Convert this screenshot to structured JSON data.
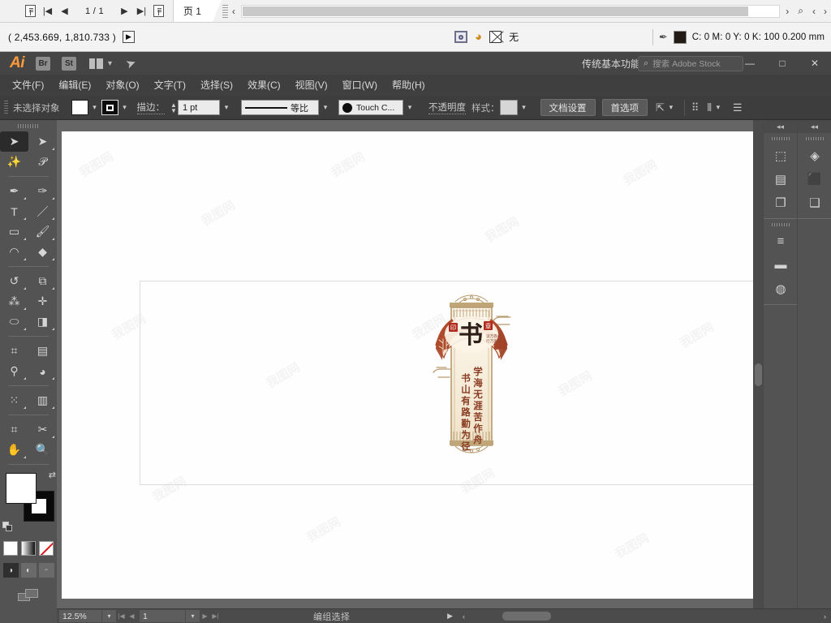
{
  "host": {
    "page_indicator": "1 / 1",
    "tab_label": "页 1",
    "coordinates": "( 2,453.669, 1,810.733 )",
    "fill_none_label": "无",
    "color_readout": "C: 0 M: 0 Y: 0 K: 100  0.200 mm"
  },
  "menubar": {
    "app_logo": "Ai",
    "bridge_badge": "Br",
    "stock_badge": "St",
    "workspace": "传统基本功能",
    "search_placeholder": "搜索 Adobe Stock",
    "minimize": "—",
    "maximize": "□",
    "close": "✕",
    "menus": [
      {
        "label": "文件(F)"
      },
      {
        "label": "编辑(E)"
      },
      {
        "label": "对象(O)"
      },
      {
        "label": "文字(T)"
      },
      {
        "label": "选择(S)"
      },
      {
        "label": "效果(C)"
      },
      {
        "label": "视图(V)"
      },
      {
        "label": "窗口(W)"
      },
      {
        "label": "帮助(H)"
      }
    ]
  },
  "controlbar": {
    "selection_label": "未选择对象",
    "stroke_label": "描边：",
    "stroke_weight": "1 pt",
    "stroke_profile": "等比",
    "brush_definition": "Touch C...",
    "opacity_label": "不透明度",
    "style_label": "样式：",
    "document_setup": "文档设置",
    "preferences": "首选项"
  },
  "toolbox": {
    "tools": [
      {
        "name": "selection-tool",
        "glyph": "➤",
        "selected": true
      },
      {
        "name": "direct-selection-tool",
        "glyph": "➤",
        "selected": false
      },
      {
        "name": "magic-wand-tool",
        "glyph": "✦",
        "selected": false
      },
      {
        "name": "lasso-tool",
        "glyph": "𝒫",
        "selected": false
      },
      {
        "name": "pen-tool",
        "glyph": "✒",
        "selected": false
      },
      {
        "name": "curvature-tool",
        "glyph": "✑",
        "selected": false
      },
      {
        "name": "type-tool",
        "glyph": "T",
        "selected": false
      },
      {
        "name": "line-segment-tool",
        "glyph": "／",
        "selected": false
      },
      {
        "name": "rectangle-tool",
        "glyph": "▭",
        "selected": false
      },
      {
        "name": "paintbrush-tool",
        "glyph": "🖌",
        "selected": false
      },
      {
        "name": "shaper-tool",
        "glyph": "◠",
        "selected": false
      },
      {
        "name": "eraser-tool",
        "glyph": "◆",
        "selected": false
      },
      {
        "name": "rotate-tool",
        "glyph": "↺",
        "selected": false
      },
      {
        "name": "scale-tool",
        "glyph": "⧉",
        "selected": false
      },
      {
        "name": "width-tool",
        "glyph": "⁂",
        "selected": false
      },
      {
        "name": "free-transform-tool",
        "glyph": "✛",
        "selected": false
      },
      {
        "name": "shape-builder-tool",
        "glyph": "⬭",
        "selected": false
      },
      {
        "name": "perspective-grid-tool",
        "glyph": "◨",
        "selected": false
      },
      {
        "name": "mesh-tool",
        "glyph": "⌗",
        "selected": false
      },
      {
        "name": "gradient-tool",
        "glyph": "▤",
        "selected": false
      },
      {
        "name": "eyedropper-tool",
        "glyph": "⚲",
        "selected": false
      },
      {
        "name": "blend-tool",
        "glyph": "◕",
        "selected": false
      },
      {
        "name": "symbol-sprayer-tool",
        "glyph": "⁙",
        "selected": false
      },
      {
        "name": "column-graph-tool",
        "glyph": "▥",
        "selected": false
      },
      {
        "name": "artboard-tool",
        "glyph": "⌗",
        "selected": false
      },
      {
        "name": "slice-tool",
        "glyph": "✂",
        "selected": false
      },
      {
        "name": "hand-tool",
        "glyph": "✋",
        "selected": false
      },
      {
        "name": "zoom-tool",
        "glyph": "🔍",
        "selected": false
      }
    ]
  },
  "rightdock": {
    "collapse_left": "◂◂",
    "collapse_right": "◂◂",
    "column_a": [
      {
        "name": "transform-panel-icon",
        "glyph": "⬚"
      },
      {
        "name": "align-panel-icon",
        "glyph": "▤"
      },
      {
        "name": "pathfinder-panel-icon",
        "glyph": "❐"
      },
      {
        "name": "stroke-panel-icon",
        "glyph": "≡"
      },
      {
        "name": "gradient-panel-icon",
        "glyph": "▬"
      },
      {
        "name": "transparency-panel-icon",
        "glyph": "◍"
      }
    ],
    "column_b": [
      {
        "name": "layers-panel-icon",
        "glyph": "◈"
      },
      {
        "name": "symbols-panel-icon",
        "glyph": "⬛"
      },
      {
        "name": "artboards-panel-icon",
        "glyph": "❑"
      }
    ]
  },
  "statusbar": {
    "zoom_level": "12.5%",
    "artboard_number": "1",
    "status_text": "编组选择"
  },
  "artwork": {
    "title_character": "书",
    "seal_left": "印",
    "seal_right": "章",
    "subtitle_line1": "读万卷书",
    "subtitle_line2": "行万里路",
    "couplet_right": "学海无涯苦作舟",
    "couplet_left": "书山有路勤为径",
    "colors": {
      "banner_brown": "#a8472c",
      "frame_tan": "#b79b6e",
      "paper_cream": "#f7f0e4",
      "ink_dark": "#3a2a20",
      "seal_red": "#b02a1f"
    }
  },
  "watermark": {
    "text": "我图网"
  }
}
